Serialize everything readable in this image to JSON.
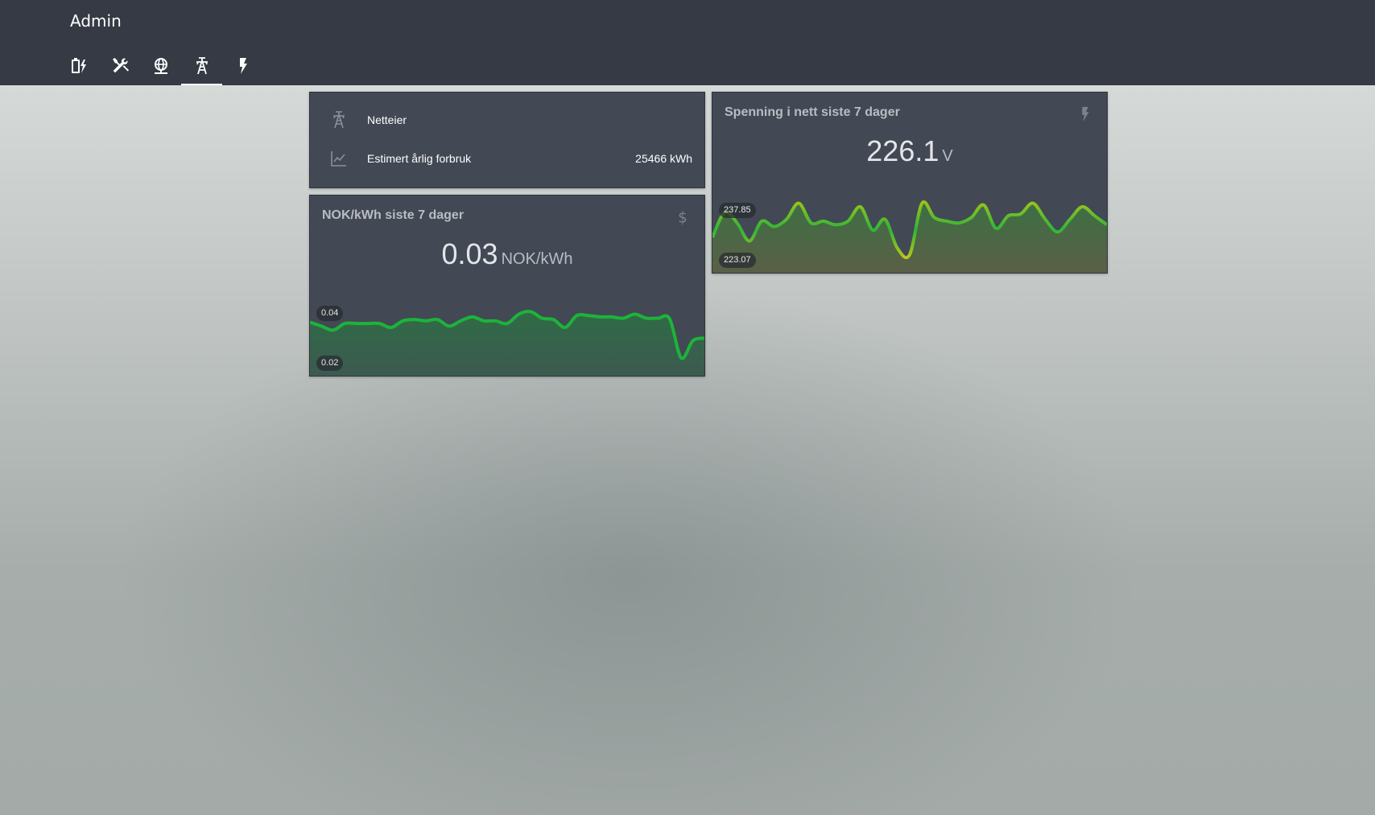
{
  "header": {
    "title": "Admin",
    "tabs": [
      {
        "icon": "battery-charging-icon",
        "active": false
      },
      {
        "icon": "tools-icon",
        "active": false
      },
      {
        "icon": "globe-network-icon",
        "active": false
      },
      {
        "icon": "transmission-tower-icon",
        "active": true
      },
      {
        "icon": "flash-icon",
        "active": false
      }
    ]
  },
  "grid_info": {
    "rows": [
      {
        "icon": "transmission-tower-icon",
        "label": "Netteier",
        "value": ""
      },
      {
        "icon": "chart-line-icon",
        "label": "Estimert årlig forbruk",
        "value": "25466 kWh"
      }
    ]
  },
  "price_card": {
    "title": "NOK/kWh siste 7 dager",
    "icon": "currency-usd-icon",
    "value": "0.03",
    "unit": "NOK/kWh",
    "max_label": "0.04",
    "min_label": "0.02"
  },
  "voltage_card": {
    "title": "Spenning i nett siste 7 dager",
    "icon": "flash-icon",
    "value": "226.1",
    "unit": "V",
    "max_label": "237.85",
    "min_label": "223.07"
  },
  "colors": {
    "topbar": "#353a44",
    "card": "#424854",
    "line_green": "#1db33a",
    "line_yellow": "#b8c61a"
  },
  "chart_data": [
    {
      "type": "area",
      "title": "NOK/kWh siste 7 dager",
      "ylim": [
        0.02,
        0.04
      ],
      "values": [
        0.0335,
        0.032,
        0.0305,
        0.033,
        0.033,
        0.033,
        0.033,
        0.0315,
        0.034,
        0.0345,
        0.034,
        0.0345,
        0.032,
        0.034,
        0.0355,
        0.034,
        0.034,
        0.033,
        0.0365,
        0.0375,
        0.035,
        0.0345,
        0.0315,
        0.036,
        0.036,
        0.0355,
        0.0355,
        0.035,
        0.0365,
        0.035,
        0.035,
        0.0348,
        0.02,
        0.0265,
        0.0275
      ]
    },
    {
      "type": "area",
      "title": "Spenning i nett siste 7 dager",
      "ylim": [
        223.07,
        237.85
      ],
      "values": [
        228,
        235,
        232,
        227,
        232.5,
        231,
        233,
        237.5,
        232,
        232.5,
        231.5,
        232.5,
        236.5,
        230,
        233,
        225,
        223.2,
        237.5,
        233.5,
        232.5,
        232,
        233.5,
        237,
        230.5,
        234,
        234.5,
        237.5,
        233,
        229.5,
        233,
        236.5,
        234,
        231.5
      ]
    }
  ]
}
